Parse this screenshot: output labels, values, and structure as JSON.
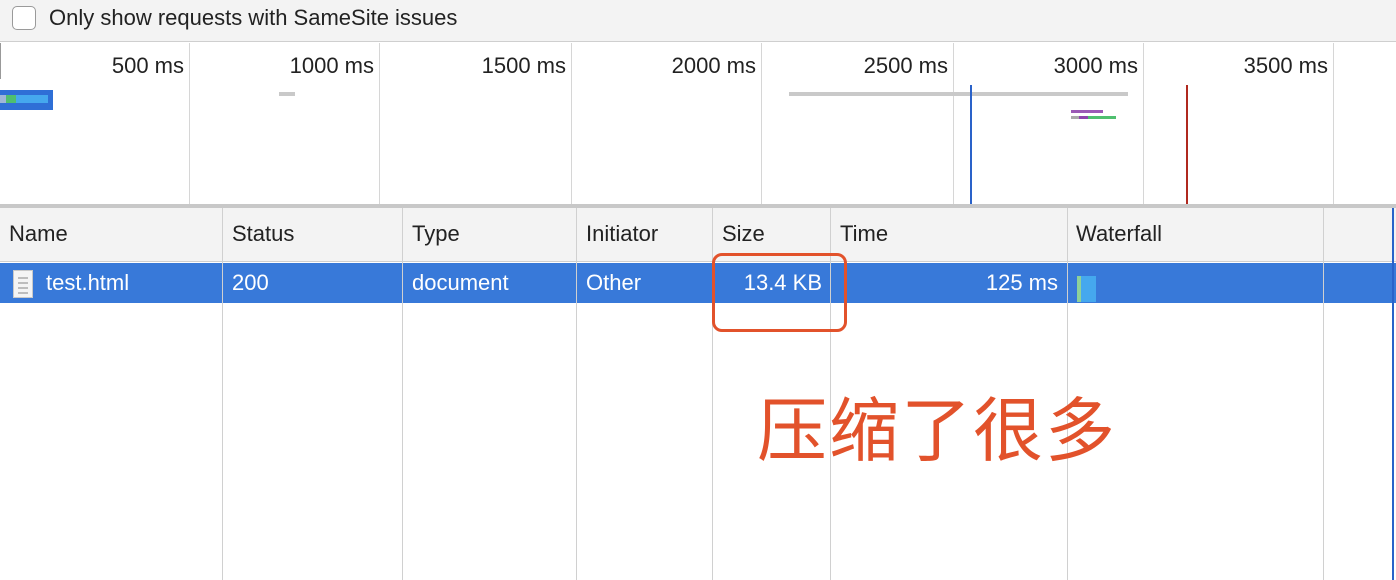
{
  "filter": {
    "checkbox_label": "Only show requests with SameSite issues",
    "checked": false
  },
  "overview": {
    "tick_labels": [
      "500 ms",
      "1000 ms",
      "1500 ms",
      "2000 ms",
      "2500 ms",
      "3000 ms",
      "3500 ms"
    ],
    "dom_content_loaded_color": "#2a62c9",
    "load_color": "#b0291f"
  },
  "table": {
    "columns": [
      "Name",
      "Status",
      "Type",
      "Initiator",
      "Size",
      "Time",
      "Waterfall"
    ],
    "rows": [
      {
        "name": "test.html",
        "status": "200",
        "type": "document",
        "initiator": "Other",
        "size": "13.4 KB",
        "time": "125 ms",
        "icon": "document-icon"
      }
    ],
    "selected_row_color": "#3879d9"
  },
  "annotation": {
    "text": "压缩了很多",
    "color": "#e2522b"
  }
}
